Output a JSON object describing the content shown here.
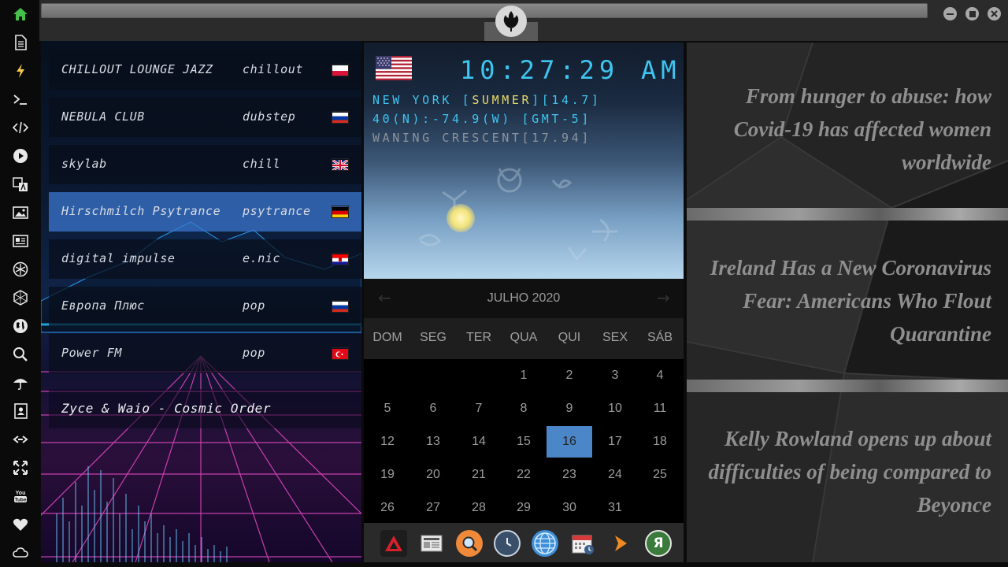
{
  "sidebar": {
    "icons": [
      "home-icon",
      "document-icon",
      "lightning-icon",
      "terminal-icon",
      "code-icon",
      "play-icon",
      "translate-icon",
      "image-icon",
      "news-icon",
      "rebel-icon",
      "hexagon-icon",
      "globe-icon",
      "search-icon",
      "umbrella-icon",
      "contacts-icon",
      "link-icon",
      "expand-icon",
      "youtube-icon",
      "heart-icon",
      "cloud-icon"
    ],
    "youtube_label": "You Tube"
  },
  "radio": {
    "stations": [
      {
        "name": "CHILLOUT LOUNGE JAZZ",
        "genre": "chillout",
        "flag": "poland"
      },
      {
        "name": "NEBULA CLUB",
        "genre": "dubstep",
        "flag": "russia"
      },
      {
        "name": "skylab",
        "genre": "chill",
        "flag": "uk"
      },
      {
        "name": "Hirschmilch Psytrance",
        "genre": "psytrance",
        "flag": "germany",
        "active": true
      },
      {
        "name": "digital impulse",
        "genre": "e.nic",
        "flag": "croatia"
      },
      {
        "name": "Европа Плюс",
        "genre": "pop",
        "flag": "russia"
      },
      {
        "name": "Power FM",
        "genre": "pop",
        "flag": "turkey"
      }
    ],
    "now_playing": "Zyce & Waio - Cosmic Order"
  },
  "clock": {
    "time": "10:27:29",
    "ampm": "AM",
    "location_prefix": "NEW YORK [",
    "season": "SUMMER",
    "location_suffix": "][14.7]",
    "coords": "40(N):-74.9(W) [GMT-5]",
    "moon": "WANING CRESCENT[17.94]"
  },
  "calendar": {
    "title": "JULHO 2020",
    "weekdays": [
      "DOM",
      "SEG",
      "TER",
      "QUA",
      "QUI",
      "SEX",
      "SÁB"
    ],
    "days": [
      "1",
      "2",
      "3",
      "4",
      "5",
      "6",
      "7",
      "8",
      "9",
      "10",
      "11",
      "12",
      "13",
      "14",
      "15",
      "16",
      "17",
      "18",
      "19",
      "20",
      "21",
      "22",
      "23",
      "24",
      "25",
      "26",
      "27",
      "28",
      "29",
      "30",
      "31"
    ],
    "today": "16",
    "prev_arrow": "←",
    "next_arrow": "→"
  },
  "dock": {
    "items": [
      "arch-app-icon",
      "newspaper-icon",
      "magnifier-icon",
      "clock-icon",
      "globe-icon",
      "calendar-icon",
      "arrow-icon",
      "yandex-icon"
    ],
    "yandex_letter": "Я"
  },
  "news": {
    "articles": [
      {
        "title": "From hunger to abuse: how Covid-19 has affected women worldwide"
      },
      {
        "title": "Ireland Has a New Coronavirus Fear: Americans Who Flout Quarantine"
      },
      {
        "title": "Kelly Rowland opens up about difficulties of being compared to Beyonce"
      }
    ]
  },
  "colors": {
    "accent_cyan": "#3ec5f0",
    "accent_yellow": "#e7d96a",
    "today_blue": "#4a86c8",
    "active_station": "#3c78d2",
    "sidebar_icon": "#e8e8e8",
    "home_icon": "#45c04a"
  }
}
